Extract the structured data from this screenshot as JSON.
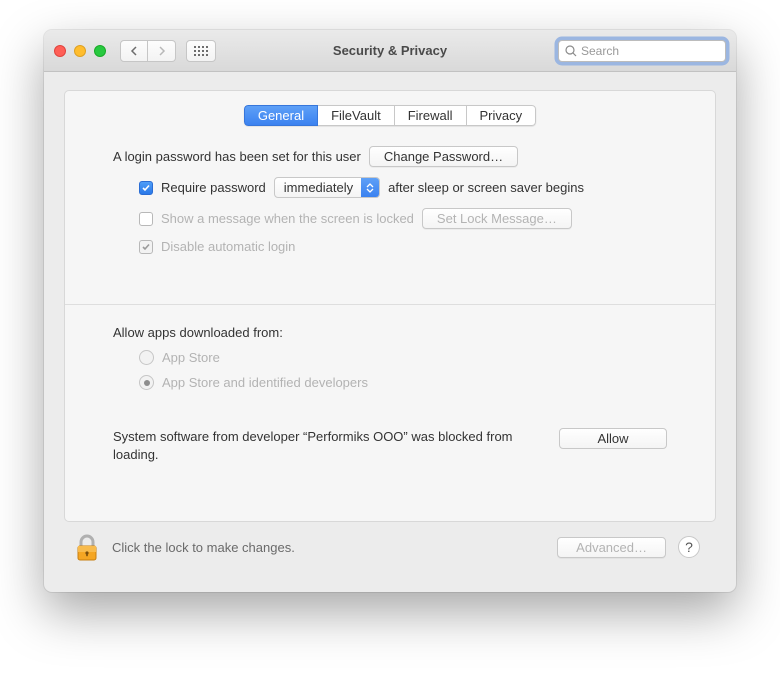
{
  "window": {
    "title": "Security & Privacy"
  },
  "search": {
    "placeholder": "Search"
  },
  "tabs": {
    "general": "General",
    "filevault": "FileVault",
    "firewall": "Firewall",
    "privacy": "Privacy"
  },
  "login": {
    "intro": "A login password has been set for this user",
    "change_btn": "Change Password…",
    "require_label_before": "Require password",
    "select_value": "immediately",
    "require_label_after": "after sleep or screen saver begins",
    "show_message": "Show a message when the screen is locked",
    "set_lock_btn": "Set Lock Message…",
    "disable_auto": "Disable automatic login"
  },
  "downloads": {
    "heading": "Allow apps downloaded from:",
    "opt1": "App Store",
    "opt2": "App Store and identified developers"
  },
  "blocked": {
    "text": "System software from developer “Performiks OOO” was blocked from loading.",
    "allow": "Allow"
  },
  "footer": {
    "lock_text": "Click the lock to make changes.",
    "advanced": "Advanced…"
  }
}
